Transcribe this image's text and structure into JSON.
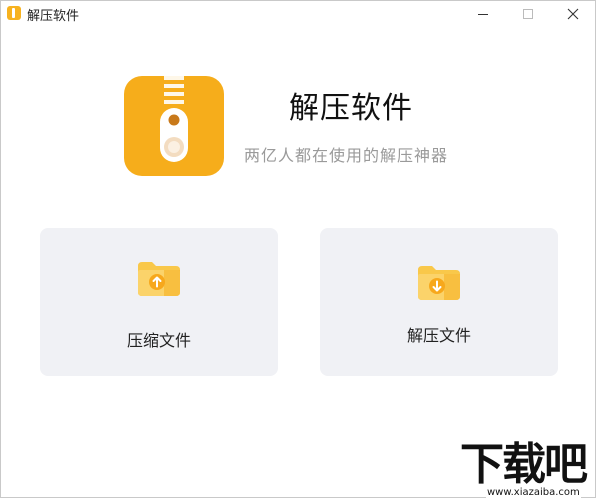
{
  "window": {
    "title": "解压软件"
  },
  "app": {
    "name": "解压软件",
    "tagline": "两亿人都在使用的解压神器",
    "brand_color": "#f6ad1b"
  },
  "actions": {
    "compress_label": "压缩文件",
    "extract_label": "解压文件",
    "compress_icon": "folder-upload-icon",
    "extract_icon": "folder-download-icon"
  },
  "watermark": {
    "text": "下载吧",
    "url": "www.xiazaiba.com"
  }
}
